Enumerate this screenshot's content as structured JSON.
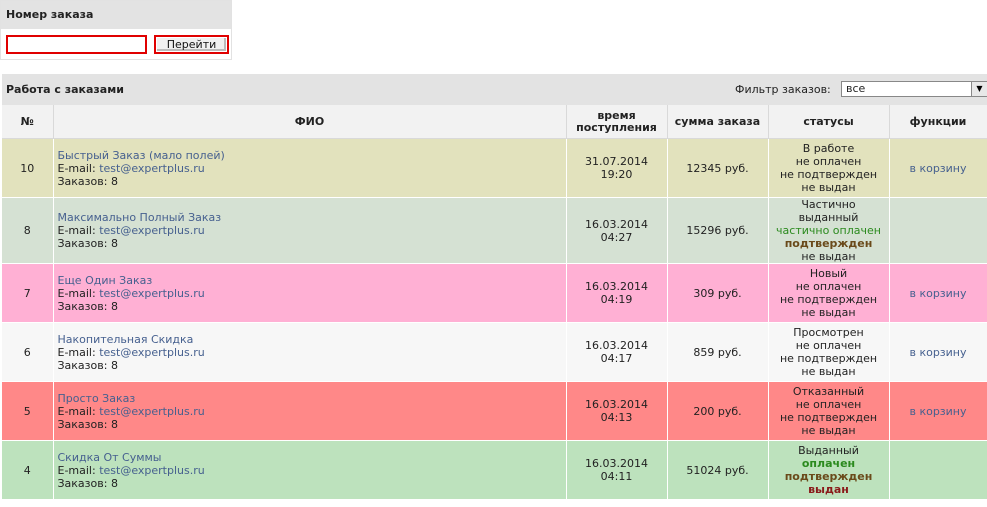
{
  "order_search": {
    "title": "Номер заказа",
    "input_value": "",
    "button_label": "Перейти"
  },
  "orders": {
    "title": "Работа с заказами",
    "filter_label": "Фильтр заказов:",
    "filter_value": "все",
    "columns": [
      "№",
      "ФИО",
      "время поступления",
      "сумма заказа",
      "статусы",
      "функции"
    ],
    "rows": [
      {
        "num": "10",
        "name": "Быстрый Заказ (мало полей)",
        "email_label": "E-mail:",
        "email": "test@expertplus.ru",
        "orders": "Заказов: 8",
        "date": "31.07.2014",
        "time": "19:20",
        "sum": "12345 руб.",
        "status1": "В работе",
        "status2": "не оплачен",
        "status3": "не подтвержден",
        "status4": "не выдан",
        "func": "в корзину",
        "bg": "#e2e2bd"
      },
      {
        "num": "8",
        "name": "Максимально Полный Заказ",
        "email_label": "E-mail:",
        "email": "test@expertplus.ru",
        "orders": "Заказов: 8",
        "date": "16.03.2014",
        "time": "04:27",
        "sum": "15296 руб.",
        "status1": "Частично выданный",
        "status2": "частично оплачен",
        "status3": "подтвержден",
        "status4": "не выдан",
        "func": "",
        "bg": "#d5e1d3"
      },
      {
        "num": "7",
        "name": "Еще Один Заказ",
        "email_label": "E-mail:",
        "email": "test@expertplus.ru",
        "orders": "Заказов: 8",
        "date": "16.03.2014",
        "time": "04:19",
        "sum": "309 руб.",
        "status1": "Новый",
        "status2": "не оплачен",
        "status3": "не подтвержден",
        "status4": "не выдан",
        "func": "в корзину",
        "bg": "#ffb0d4"
      },
      {
        "num": "6",
        "name": "Накопительная Скидка",
        "email_label": "E-mail:",
        "email": "test@expertplus.ru",
        "orders": "Заказов: 8",
        "date": "16.03.2014",
        "time": "04:17",
        "sum": "859 руб.",
        "status1": "Просмотрен",
        "status2": "не оплачен",
        "status3": "не подтвержден",
        "status4": "не выдан",
        "func": "в корзину",
        "bg": "#f7f7f7"
      },
      {
        "num": "5",
        "name": "Просто Заказ",
        "email_label": "E-mail:",
        "email": "test@expertplus.ru",
        "orders": "Заказов: 8",
        "date": "16.03.2014",
        "time": "04:13",
        "sum": "200 руб.",
        "status1": "Отказанный",
        "status2": "не оплачен",
        "status3": "не подтвержден",
        "status4": "не выдан",
        "func": "в корзину",
        "bg": "#ff8888"
      },
      {
        "num": "4",
        "name": "Скидка От Суммы",
        "email_label": "E-mail:",
        "email": "test@expertplus.ru",
        "orders": "Заказов: 8",
        "date": "16.03.2014",
        "time": "04:11",
        "sum": "51024 руб.",
        "status1": "Выданный",
        "status2": "оплачен",
        "status3": "подтвержден",
        "status4": "выдан",
        "func": "",
        "bg": "#bde2bd"
      }
    ]
  }
}
